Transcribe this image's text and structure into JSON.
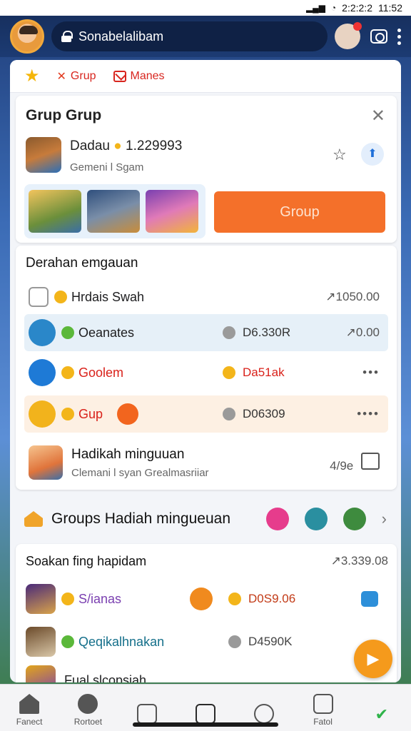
{
  "status_bar": {
    "time": "11:52",
    "other": "2:2:2:2"
  },
  "app_bar": {
    "url": "Sonabelalibam"
  },
  "tabs": [
    {
      "label": "Grup",
      "icon": "badge-x-icon"
    },
    {
      "label": "Manes",
      "icon": "mail-icon"
    }
  ],
  "group_card": {
    "title": "Grup Grup",
    "profile_name": "Dadau",
    "profile_amount": "1.229993",
    "profile_sub": "Gemeni l Sgam",
    "group_button": "Group"
  },
  "list": {
    "title": "Derahan emgauan",
    "rows": [
      {
        "label": "Hrdais Swah",
        "right": "↗1050.00"
      },
      {
        "label": "Oeanates",
        "mid": "D6.330R",
        "right": "↗0.00"
      },
      {
        "label": "Goolem",
        "mid": "Da51ak",
        "right": "•••"
      },
      {
        "label": "Gup",
        "mid": "D06309",
        "right": "••••"
      },
      {
        "label": "Hadikah minguuan",
        "sub": "Clemani l syan  Grealmasriiar",
        "right": "4/9e"
      }
    ]
  },
  "category": {
    "title": "Groups Hadiah mingueuan"
  },
  "bottom": {
    "title": "Soakan fing hapidam",
    "right": "↗3.339.08",
    "rows": [
      {
        "label": "S/ianas",
        "mid": "D0S9.06"
      },
      {
        "label": "Qeqikalhnakan",
        "mid": "D4590K"
      },
      {
        "label": "Fual slcopsiah",
        "mid": ""
      }
    ]
  },
  "navbar": [
    {
      "label": "Fanect",
      "icon": "home-icon"
    },
    {
      "label": "Rortoet",
      "icon": "bell-icon"
    },
    {
      "label": "",
      "icon": "tv-icon"
    },
    {
      "label": "",
      "icon": "star-icon"
    },
    {
      "label": "",
      "icon": "clock-icon"
    },
    {
      "label": "Fatol",
      "icon": "box-icon"
    },
    {
      "label": "",
      "icon": "check-icon"
    }
  ]
}
